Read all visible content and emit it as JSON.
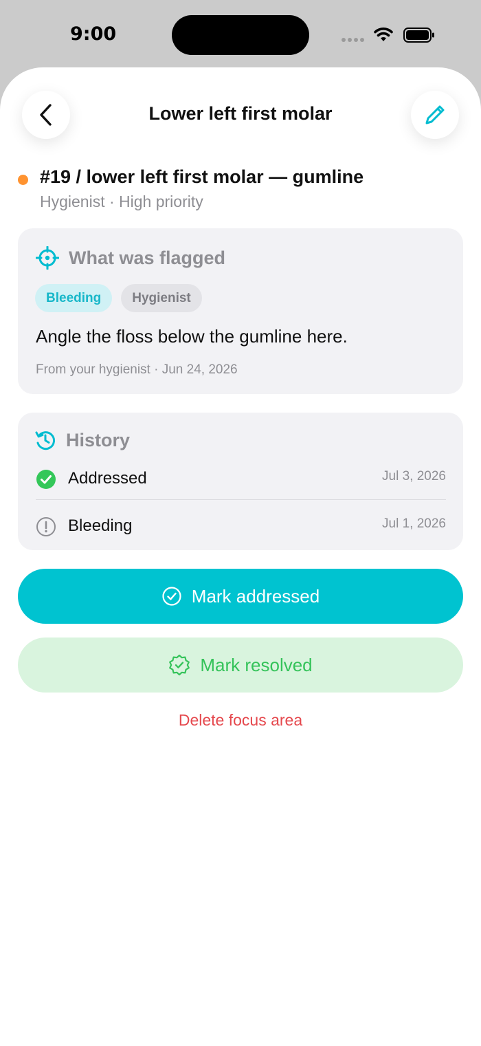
{
  "status_bar": {
    "time": "9:00"
  },
  "nav": {
    "title": "Lower left first molar",
    "back_icon": "chevron-left-icon",
    "edit_icon": "pencil-icon"
  },
  "focus_area": {
    "title": "#19 / lower left first molar — gumline",
    "subtitle": "Hygienist · High priority",
    "priority_color": "#ff9330"
  },
  "flag_card": {
    "header": "What was flagged",
    "tags": [
      "Bleeding",
      "Hygienist"
    ],
    "note": "Angle the floss below the gumline here.",
    "meta": "From your hygienist · Jun 24, 2026"
  },
  "history": {
    "header": "History",
    "entries": [
      {
        "label": "Addressed",
        "date": "Jul 3, 2026",
        "icon": "check-circle-icon"
      },
      {
        "label": "Bleeding",
        "date": "Jul 1, 2026",
        "icon": "exclamation-circle-icon"
      }
    ]
  },
  "actions": {
    "mark_addressed": "Mark addressed",
    "mark_resolved": "Mark resolved",
    "delete": "Delete focus area"
  },
  "colors": {
    "accent": "#00c3d0",
    "success": "#35c35a",
    "danger": "#e5484d",
    "priority": "#ff9330"
  }
}
